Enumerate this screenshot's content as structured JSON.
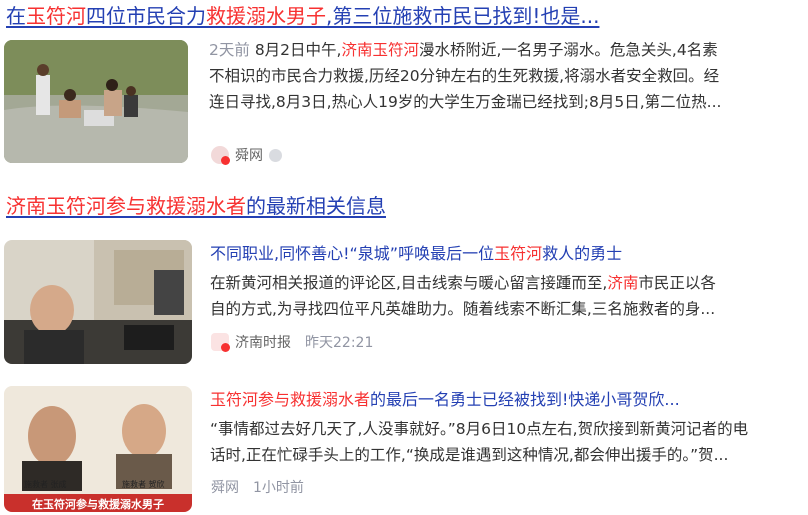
{
  "result1": {
    "title_parts": [
      "在",
      "玉符河",
      "四位市民合力",
      "救援溺水",
      "男子",
      ",第三位施救市民已找到!也是..."
    ],
    "time": "2天前",
    "snippet_lines": [
      "8月2日中午,",
      "济南玉符河",
      "漫水桥附近,一名男子溺水。危急关头,4名素",
      "不相识的市民合力救援,历经20分钟左右的生死救援,将溺水者安全救回。经",
      "连日寻找,8月3日,热心人19岁的大学生万金瑞已经找到;8月5日,第二位热..."
    ],
    "source": "舜网"
  },
  "section_heading": {
    "highlight": "济南玉符河参与救援溺水者",
    "rest": "的最新相关信息"
  },
  "item1": {
    "title_plain1": "不同职业,同怀善心!“泉城”呼唤最后一位",
    "title_hl": "玉符河",
    "title_plain2": "救人的勇士",
    "snippet_line1_a": "在新黄河相关报道的评论区,目击线索与暖心留言接踵而至,",
    "snippet_line1_hl": "济南",
    "snippet_line1_b": "市民正以各",
    "snippet_line2": "自的方式,为寻找四位平凡英雄助力。随着线索不断汇集,三名施救者的身...",
    "source": "济南时报",
    "time": "昨天22:21"
  },
  "item2": {
    "title_hl": "玉符河参与救援溺水者",
    "title_plain": "的最后一名勇士已经被找到!快递小哥贺欣...",
    "snippet_line1": "“事情都过去好几天了,人没事就好。”8月6日10点左右,贺欣接到新黄河记者的电",
    "snippet_line2": "话时,正在忙碌手头上的工作,“换成是谁遇到这种情况,都会伸出援手的。”贺...",
    "source": "舜网",
    "time": "1小时前",
    "thumb_captions": [
      "施救者 张成",
      "施救者 贺欣"
    ],
    "thumb_banner": "在玉符河参与救援溺水男子"
  },
  "colors": {
    "link": "#2440b3",
    "highlight": "#f73131",
    "meta": "#9195a3"
  }
}
